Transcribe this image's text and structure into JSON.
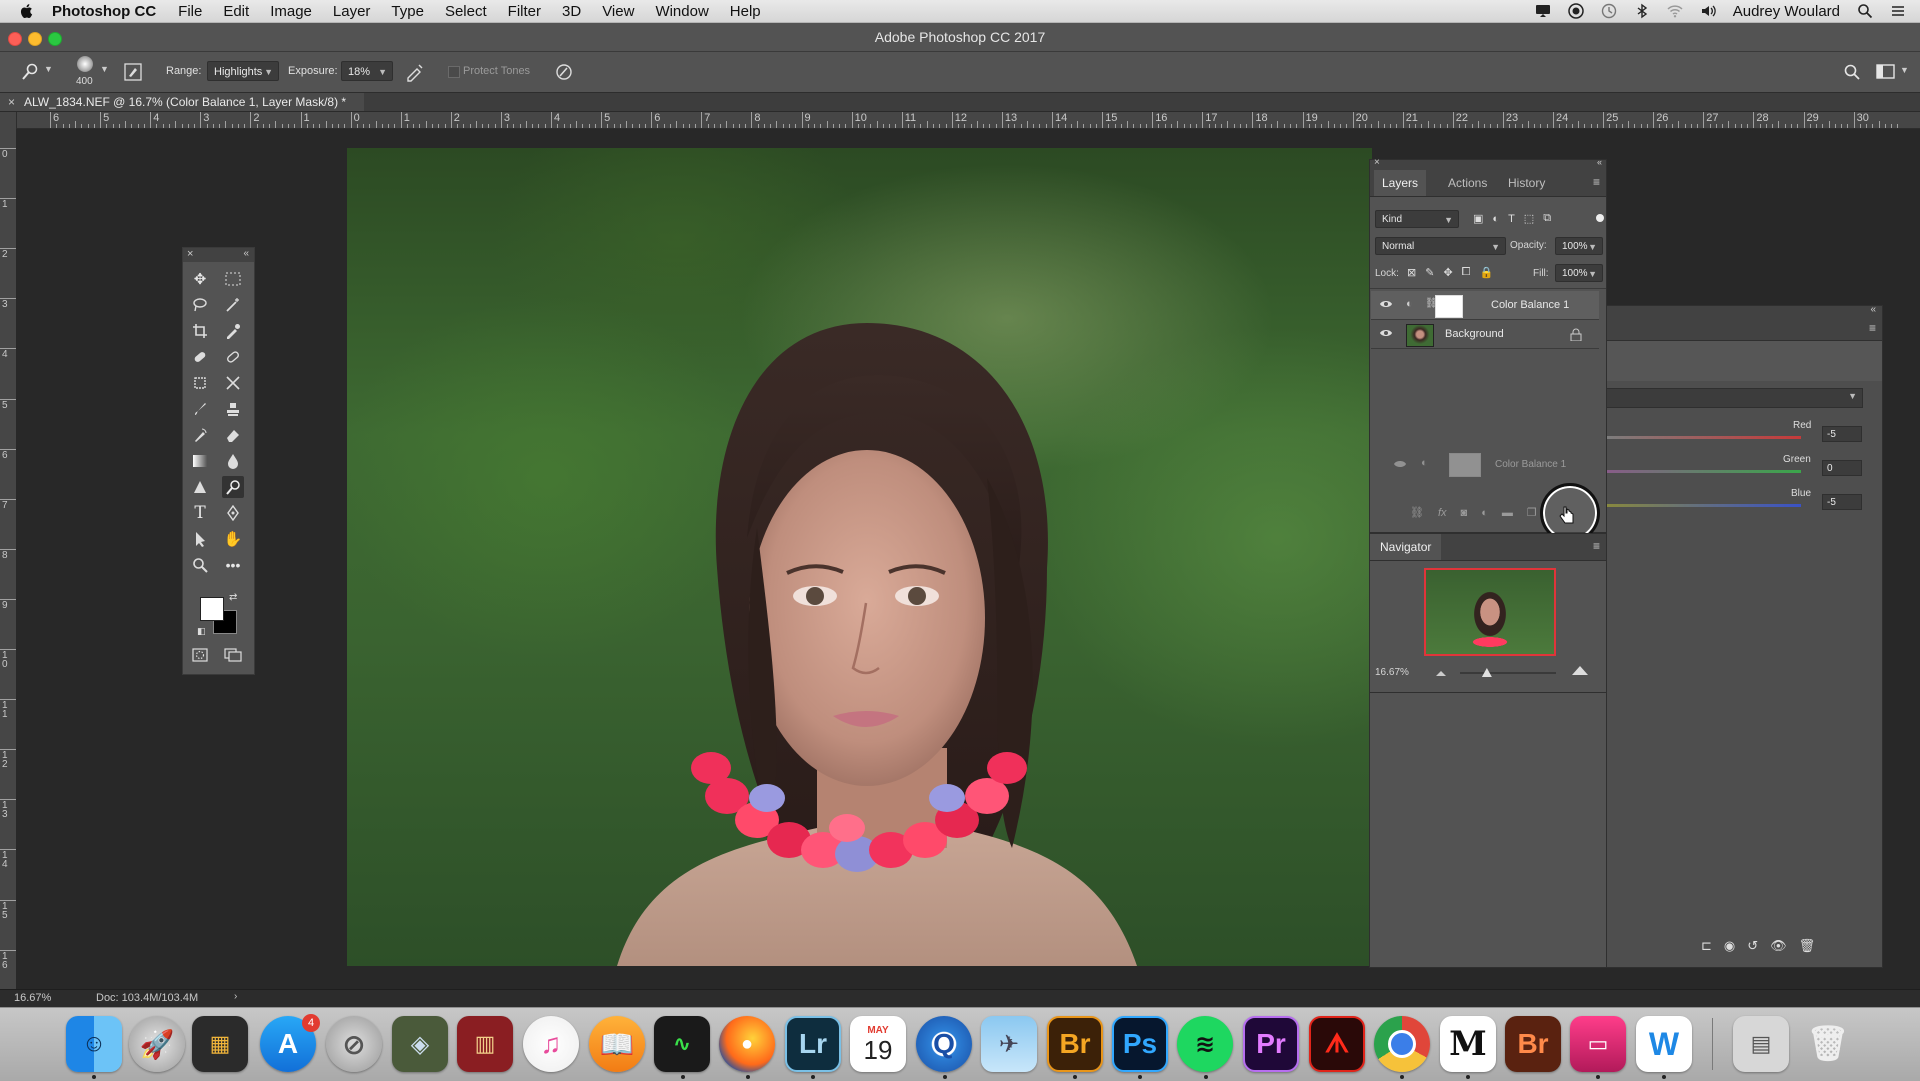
{
  "menubar": {
    "app_name": "Photoshop CC",
    "items": [
      "File",
      "Edit",
      "Image",
      "Layer",
      "Type",
      "Select",
      "Filter",
      "3D",
      "View",
      "Window",
      "Help"
    ],
    "user_name": "Audrey Woulard"
  },
  "window": {
    "title": "Adobe Photoshop CC 2017"
  },
  "options_bar": {
    "brush_size": "400",
    "range_label": "Range:",
    "range_value": "Highlights",
    "exposure_label": "Exposure:",
    "exposure_value": "18%",
    "protect_tones_label": "Protect Tones"
  },
  "document": {
    "tab_title": "ALW_1834.NEF @ 16.7% (Color Balance 1, Layer Mask/8) *",
    "close_glyph": "×"
  },
  "rulers": {
    "h_labels": [
      "6",
      "5",
      "4",
      "3",
      "2",
      "1",
      "0",
      "1",
      "2",
      "3",
      "4",
      "5",
      "6",
      "7",
      "8",
      "9",
      "10",
      "11",
      "12",
      "13",
      "14",
      "15",
      "16",
      "17",
      "18",
      "19",
      "20",
      "21",
      "22",
      "23",
      "24",
      "25",
      "26",
      "27",
      "28",
      "29",
      "30"
    ],
    "v_labels": [
      "0",
      "1",
      "2",
      "3",
      "4",
      "5",
      "6",
      "7",
      "8",
      "9",
      "1\n0",
      "1\n1",
      "1\n2",
      "1\n3",
      "1\n4",
      "1\n5",
      "1\n6"
    ]
  },
  "layers_panel": {
    "tabs": [
      "Layers",
      "Actions",
      "History"
    ],
    "filter_kind": "Kind",
    "blend_mode": "Normal",
    "opacity_label": "Opacity:",
    "opacity_value": "100%",
    "lock_label": "Lock:",
    "fill_label": "Fill:",
    "fill_value": "100%",
    "layers": [
      {
        "name": "Color Balance 1",
        "selected": true
      },
      {
        "name": "Background",
        "selected": false
      }
    ],
    "ghost_layer_name": "Color Balance 1"
  },
  "navigator_panel": {
    "title": "Navigator",
    "zoom_value": "16.67%",
    "zoom_slider_fraction": 0.28
  },
  "properties_panel": {
    "channels": [
      {
        "label": "Red",
        "value": "-5",
        "color": "#c63a3a"
      },
      {
        "label": "Green",
        "value": "0",
        "color": "#3aa64a"
      },
      {
        "label": "Blue",
        "value": "-5",
        "color": "#3a52c6"
      }
    ]
  },
  "status_bar": {
    "zoom": "16.67%",
    "doc_info": "Doc: 103.4M/103.4M"
  },
  "dock": {
    "lightroom_label": "Lr",
    "bridge_label": "Br",
    "photoshop_label": "Ps",
    "premiere_label": "Pr",
    "bridge2_label": "Br",
    "calendar_month": "MAY",
    "calendar_day": "19",
    "appstore_badge": "4"
  },
  "colors": {
    "ps_blue": "#31a8ff",
    "ps_panel": "#535353",
    "ps_dark": "#282828",
    "selection_ring": "#111111"
  }
}
